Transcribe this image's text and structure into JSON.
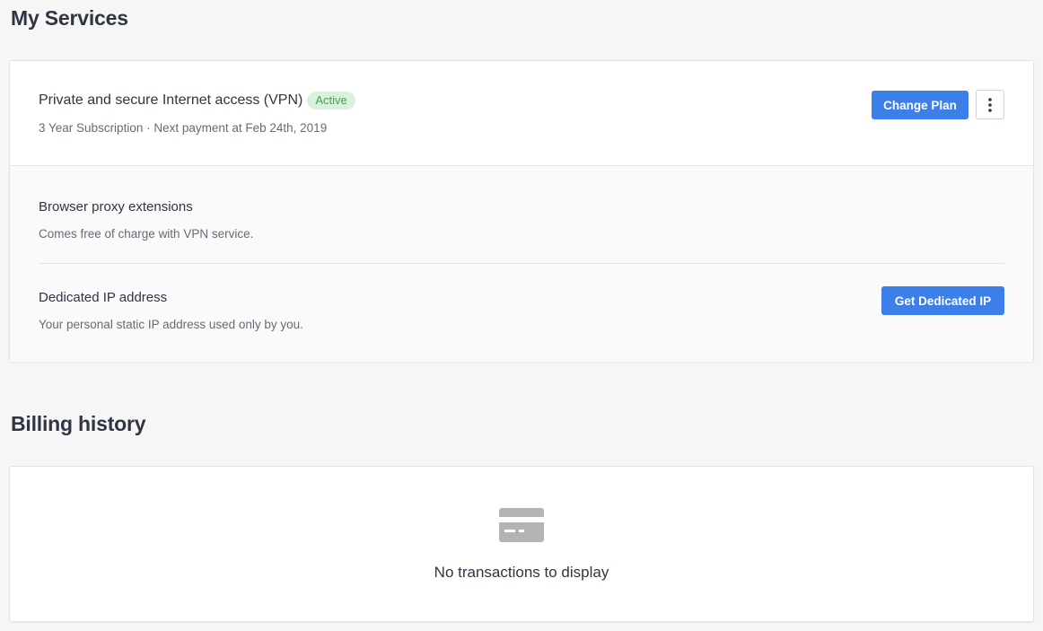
{
  "services": {
    "title": "My Services",
    "vpn": {
      "title": "Private and secure Internet access (VPN)",
      "status": "Active",
      "subtitle": "3 Year Subscription · Next payment at Feb 24th, 2019",
      "change_plan_label": "Change Plan",
      "more_icon": "more-vertical-icon"
    },
    "addons": [
      {
        "title": "Browser proxy extensions",
        "description": "Comes free of charge with VPN service."
      },
      {
        "title": "Dedicated IP address",
        "description": "Your personal static IP address used only by you.",
        "button_label": "Get Dedicated IP"
      }
    ]
  },
  "billing": {
    "title": "Billing history",
    "empty_icon": "credit-card-icon",
    "empty_text": "No transactions to display"
  },
  "colors": {
    "background": "#f6f6f6",
    "primary_button": "#3d7fe8",
    "active_badge_bg": "#d9f2dd",
    "active_badge_text": "#38a84a",
    "icon_gray": "#b4b4b4"
  }
}
